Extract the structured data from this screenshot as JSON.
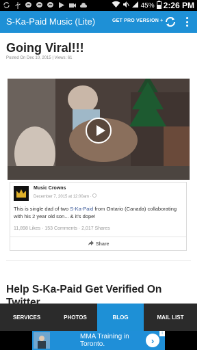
{
  "status_bar": {
    "time": "2:26 PM",
    "battery": "45%",
    "icons": [
      "sync-icon",
      "usb-icon",
      "messenger-icon",
      "messenger-icon",
      "messenger-icon",
      "play-icon",
      "video-icon",
      "cloud-icon",
      "wifi-icon",
      "mute-icon",
      "signal-icon",
      "battery-icon"
    ]
  },
  "app_bar": {
    "title": "S-Ka-Paid Music (Lite)",
    "pro_label": "GET PRO VERSION +",
    "refresh_icon": "refresh-icon",
    "menu_icon": "more-vert-icon",
    "color": "#1e90d6"
  },
  "post": {
    "title": "Going Viral!!!",
    "meta_date": "Posted On Dec 10, 2015 | ",
    "meta_views": "Views: 61"
  },
  "fb_embed": {
    "page_name": "Music Crowns",
    "date": "December 7, 2015 at 12:00am · ",
    "text_before": "This is single dad of two ",
    "link_text": "S-Ka-Paid",
    "text_after": " from Ontario (Canada) collaborating with his 2 year old son... & it's dope!",
    "stats": "11,898 Likes · 153 Comments · 2,017 Shares",
    "share_label": "Share"
  },
  "post2": {
    "title": "Help S-Ka-Paid Get Verified On Twitter"
  },
  "tabs": [
    {
      "label": "SERVICES",
      "active": false
    },
    {
      "label": "PHOTOS",
      "active": false
    },
    {
      "label": "BLOG",
      "active": true
    },
    {
      "label": "MAIL LIST",
      "active": false
    }
  ],
  "ad": {
    "text_line1": "MMA Training in",
    "text_line2": "Toronto."
  },
  "colors": {
    "accent": "#1e90d6",
    "tab_bar": "#2b2b2b"
  }
}
